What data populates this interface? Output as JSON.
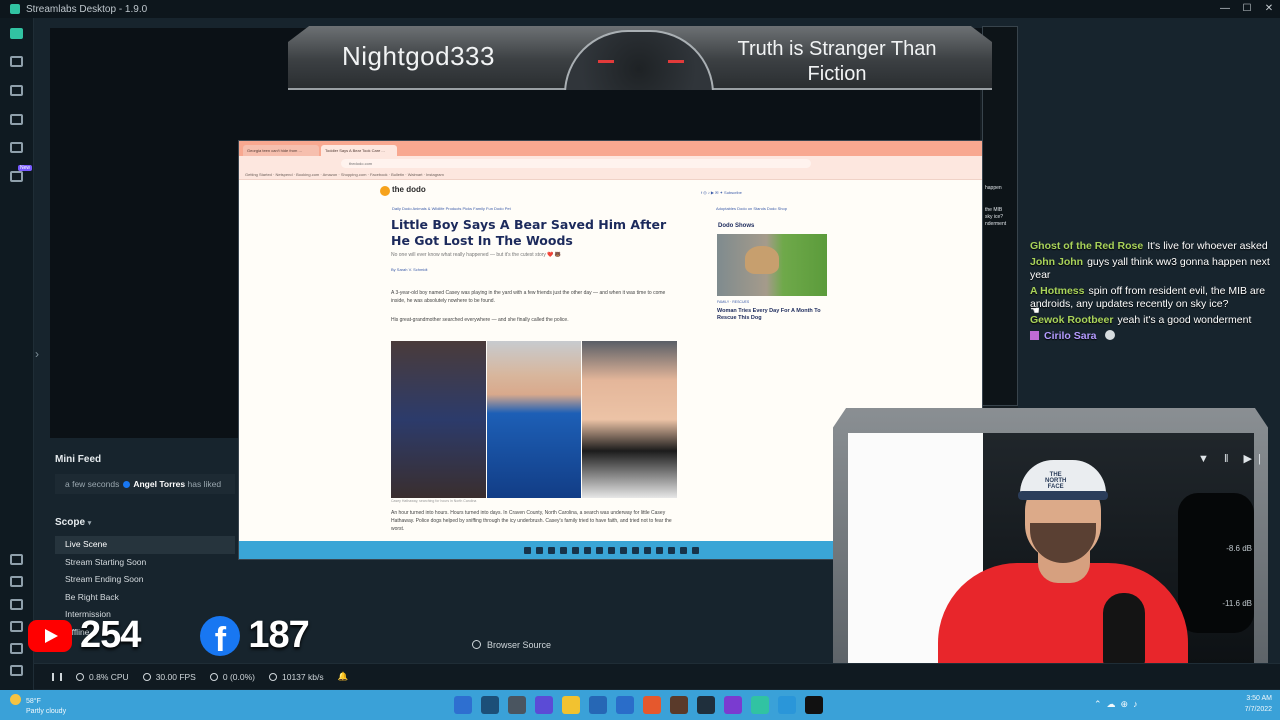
{
  "app": {
    "title": "Streamlabs Desktop - 1.9.0",
    "window_controls": [
      "—",
      "☐",
      "✕"
    ]
  },
  "overlay": {
    "streamer_name": "Nightgod333",
    "tagline": "Truth is Stranger Than Fiction"
  },
  "captured_browser": {
    "tabs": [
      "Georgia teen can't hide from ...",
      "Toddler Says A Bear Took Care ..."
    ],
    "url": "thedodo.com",
    "bookmarks": "Getting Started  ·  Netspend  ·  Booking.com  ·  Amazon  ·  Shopping.com  ·  Facebook  ·  Bulletin  ·  Walmart  ·  Instagram",
    "site_logo": "the dodo",
    "site_nav": "Daily Dodo    Animals & Wildlife    Products Picks    Family Fun    Dodo Pet",
    "site_nav_right": "Adoptables    Dodo on Stands    Dodo Shop",
    "social_bar": "f   ◎   ♪   ▶   ✉   ✦      Subscribe",
    "headline": "Little Boy Says A Bear Saved Him After He Got Lost In The Woods",
    "subhead": "No one will ever know what really happened — but it's the cutest story ❤️ 🐻",
    "byline": "By Sarah V. Schmidt",
    "para1": "A 3-year-old boy named Casey was playing in the yard with a few friends just the other day — and when it was time to come inside, he was absolutely nowhere to be found.",
    "para2": "His great-grandmother searched everywhere — and she finally called the police.",
    "photo_caption": "Casey Hathaway, searching for hours in North Carolina",
    "para3": "An hour turned into hours. Hours turned into days. In Craven County, North Carolina, a search was underway for little Casey Hathaway. Police dogs helped by sniffing through the icy underbrush. Casey's family tried to have faith, and tried not to fear the worst.",
    "sidebar_heading": "Dodo Shows",
    "sidebar_tag": "FAMILY · RESCUES",
    "sidebar_caption": "Woman Tries Every Day For A Month To Rescue This Dog"
  },
  "chat": [
    {
      "user": "Ghost of the Red Rose",
      "text": "It's live for whoever asked"
    },
    {
      "user": "John John",
      "text": "guys yall think ww3 gonna happen next year"
    },
    {
      "user": "A Hotmess",
      "text": "spin off from resident evil, the MIB are androids, any updates recently on sky ice?"
    },
    {
      "user": "Gewok Rootbeer",
      "text": "yeah it's a good wonderment"
    },
    {
      "user": "Cirilo Sara",
      "text": ""
    }
  ],
  "mini_window_text": [
    "happen",
    "...",
    "the MIB",
    "sky ice?",
    "nderment"
  ],
  "mini_feed": {
    "title": "Mini Feed",
    "time": "a few seconds",
    "user": "Angel Torres",
    "action": "has liked"
  },
  "scope": {
    "title": "Scope",
    "scenes": [
      "Live Scene",
      "Stream Starting Soon",
      "Stream Ending Soon",
      "Be Right Back",
      "Intermission",
      "Offline"
    ],
    "active_scene": "Live Scene"
  },
  "social_counts": {
    "youtube": "254",
    "facebook": "187"
  },
  "source_item": "Browser Source",
  "mixer": {
    "controls": "▼ ‖ ▶|",
    "values": [
      "-8.6 dB",
      "-11.6 dB"
    ]
  },
  "stats": {
    "cpu": "0.8% CPU",
    "fps": "30.00 FPS",
    "dropped": "0 (0.0%)",
    "bitrate": "10137 kb/s"
  },
  "taskbar": {
    "weather_temp": "58°F",
    "weather_desc": "Partly cloudy",
    "time": "3:50 AM",
    "date": "7/7/2022"
  },
  "colors": {
    "accent": "#31c3a2",
    "chat_name": "#a9d35a",
    "youtube": "#ff0000",
    "facebook": "#1877f2",
    "taskbar": "#3aa1d8"
  }
}
